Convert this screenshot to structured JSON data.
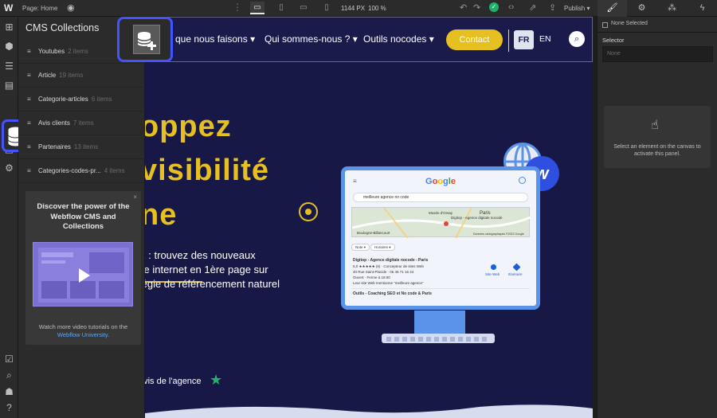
{
  "topbar": {
    "page_label": "Page: Home",
    "width_readout": "1144 PX",
    "zoom_readout": "100 %",
    "publish_label": "Publish",
    "publish_caret": "▾"
  },
  "cms_panel": {
    "title": "CMS Collections",
    "collections": [
      {
        "name": "Youtubes",
        "count": "2 items"
      },
      {
        "name": "Article",
        "count": "19 items"
      },
      {
        "name": "Categorie-articles",
        "count": "6 items"
      },
      {
        "name": "Avis clients",
        "count": "7 items"
      },
      {
        "name": "Partenaires",
        "count": "13 items"
      },
      {
        "name": "Categories-codes-pr...",
        "count": "4 items"
      }
    ],
    "promo": {
      "close": "×",
      "heading": "Discover the power of the Webflow CMS and Collections",
      "footer": "Watch more video tutorials on the",
      "footer_link": "Webflow University"
    }
  },
  "site": {
    "nav": {
      "link1": "que nous faisons ▾",
      "link2": "Qui sommes-nous ? ▾",
      "link3": "Outils nocodes ▾",
      "contact": "Contact",
      "lang_fr": "FR",
      "lang_en": "EN"
    },
    "hero": {
      "line1": "oppez",
      "line2": "visibilité",
      "line3": "ne"
    },
    "subtext": {
      "line1": "E : trouvez des nouveaux",
      "line2": "ite internet",
      "line2_rest": " en 1ère page sur",
      "line3": "tégie de référencement naturel"
    },
    "review": "avis de l'agence",
    "monitor": {
      "google": "Google",
      "search_query": "meilleure agence no code",
      "map_paris": "Paris",
      "map_agency": "Digitop - Agence digitale nocode",
      "map_boulogne": "Boulogne-Billancourt",
      "map_musee": "Musée d'Orsay",
      "map_footer": "Données cartographiques ©2022 Google",
      "filter_note": "Note ▾",
      "filter_hours": "Horaires ▾",
      "result_title": "Digitop - Agence digitale nocode - Paris",
      "result_rating": "5,0 ★★★★★ (6) · Concepteur de sites Web",
      "result_address": "40 Rue Saint-Placide · 06 46 71 16 44",
      "result_hours": "Ouvert · Ferme à 18:00",
      "result_mention": "Leur site Web mentionne \"meilleure agence\"",
      "action_site": "Site Web",
      "action_route": "Itinéraire",
      "result2": "Outils - Coaching SEO et No code & Paris"
    }
  },
  "right_panel": {
    "none_selected": "None Selected",
    "selector_label": "Selector",
    "selector_placeholder": "None",
    "empty_msg": "Select an element on the canvas to activate this panel."
  },
  "colors": {
    "accent_blue": "#4353ff",
    "site_navy": "#171846",
    "site_yellow": "#e6bf21",
    "trustpilot_green": "#1fb26b"
  },
  "icons": {
    "logo": "W",
    "eye": "eye-icon",
    "database_add": "database-add-icon"
  }
}
